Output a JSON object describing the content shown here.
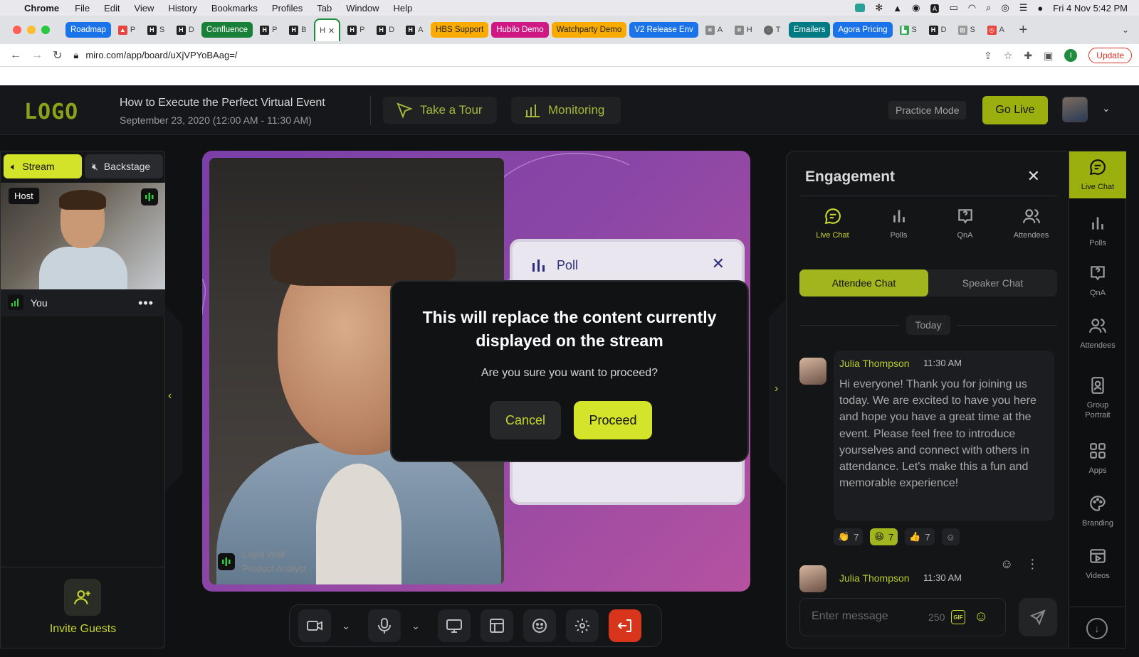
{
  "os_menubar": {
    "app": "Chrome",
    "menus": [
      "File",
      "Edit",
      "View",
      "History",
      "Bookmarks",
      "Profiles",
      "Tab",
      "Window",
      "Help"
    ],
    "clock": "Fri 4 Nov  5:42 PM"
  },
  "browser": {
    "tab_groups": [
      {
        "label": "Roadmap",
        "color": "#1a73e8"
      },
      {
        "label": "Confluence",
        "color": "#188038"
      },
      {
        "label": "HBS Support",
        "color": "#f9ab00"
      },
      {
        "label": "Hubilo Demo",
        "color": "#d01884"
      },
      {
        "label": "Watchparty Demo",
        "color": "#f9ab00"
      },
      {
        "label": "V2 Release Env",
        "color": "#1a73e8"
      },
      {
        "label": "Emailers",
        "color": "#007b83"
      },
      {
        "label": "Agora Pricing",
        "color": "#1a73e8"
      }
    ],
    "mini_tabs": [
      "P",
      "S",
      "D",
      "P",
      "B",
      "H",
      "P",
      "D",
      "A",
      "A",
      "H",
      "T",
      "S",
      "D",
      "S",
      "A"
    ],
    "url": "miro.com/app/board/uXjVPYoBAag=/",
    "profile_initial": "I",
    "update_label": "Update"
  },
  "header": {
    "logo": "LOGO",
    "event_title": "How to Execute the Perfect Virtual Event",
    "event_date": "September 23, 2020 (12:00 AM - 11:30 AM)",
    "take_tour": "Take a Tour",
    "monitoring": "Monitoring",
    "practice_mode": "Practice Mode",
    "go_live": "Go Live"
  },
  "left_panel": {
    "stream_tab": "Stream",
    "backstage_tab": "Backstage",
    "host_label": "Host",
    "you_label": "You",
    "invite_guests": "Invite Guests"
  },
  "stage": {
    "speaker_name": "Layla Wolf",
    "speaker_role": "Product Analyst",
    "poll_title": "Poll"
  },
  "modal": {
    "title": "This will replace the content currently displayed on the stream",
    "subtitle": "Are you sure you want to proceed?",
    "cancel": "Cancel",
    "proceed": "Proceed"
  },
  "engagement": {
    "title": "Engagement",
    "tabs": [
      "Live Chat",
      "Polls",
      "QnA",
      "Attendees"
    ],
    "attendee_chat": "Attendee Chat",
    "speaker_chat": "Speaker Chat",
    "today": "Today",
    "messages": [
      {
        "author": "Julia Thompson",
        "time": "11:30 AM",
        "text": "Hi everyone! Thank you for joining us today. We are excited to have you here and hope you have a great time at the event. Please feel free to introduce yourselves and connect with others in attendance. Let's make this a fun and memorable experience!",
        "reactions": [
          {
            "emoji": "👏",
            "count": "7"
          },
          {
            "emoji": "😆",
            "count": "7"
          },
          {
            "emoji": "👍",
            "count": "7"
          }
        ]
      },
      {
        "author": "Julia Thompson",
        "time": "11:30 AM"
      }
    ],
    "input_placeholder": "Enter message",
    "char_count": "250",
    "gif_label": "GIF"
  },
  "rail": {
    "items": [
      "Live Chat",
      "Polls",
      "QnA",
      "Attendees",
      "Group Portrait",
      "Apps",
      "Branding",
      "Videos"
    ]
  },
  "colors": {
    "accent": "#d4e42a",
    "leave_red": "#d8351d",
    "stage_purple": "#8a46a6"
  }
}
